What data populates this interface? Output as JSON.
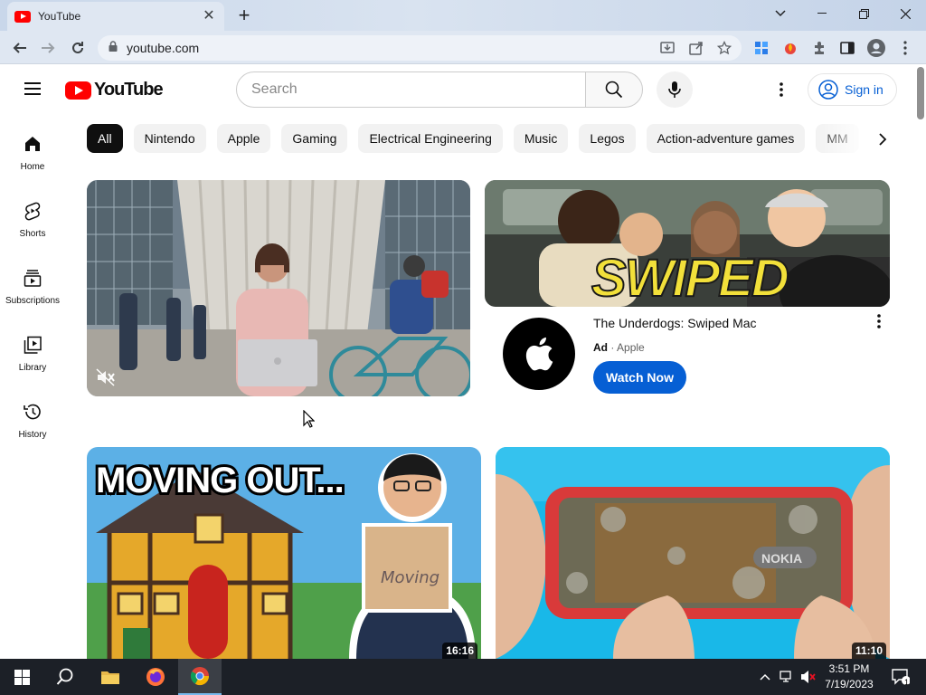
{
  "browser": {
    "tab_title": "YouTube",
    "url": "youtube.com"
  },
  "masthead": {
    "logo_text": "YouTube",
    "search_placeholder": "Search",
    "signin_label": "Sign in"
  },
  "chips": [
    "All",
    "Nintendo",
    "Apple",
    "Gaming",
    "Electrical Engineering",
    "Music",
    "Legos",
    "Action-adventure games",
    "MM"
  ],
  "guide": [
    {
      "label": "Home",
      "icon": "home-icon"
    },
    {
      "label": "Shorts",
      "icon": "shorts-icon"
    },
    {
      "label": "Subscriptions",
      "icon": "subscriptions-icon"
    },
    {
      "label": "Library",
      "icon": "library-icon"
    },
    {
      "label": "History",
      "icon": "history-icon"
    }
  ],
  "ad": {
    "thumbnail_text": "SWIPED",
    "title": "The Underdogs: Swiped Mac",
    "tag": "Ad",
    "advertiser": "Apple",
    "cta_label": "Watch Now"
  },
  "videos": [
    {
      "thumbnail_text": "MOVING OUT...",
      "box_text": "Moving",
      "duration": "16:16"
    },
    {
      "thumbnail_text": "NOKIA",
      "duration": "11:10"
    }
  ],
  "taskbar": {
    "time": "3:51 PM",
    "date": "7/19/2023",
    "notification_count": "1"
  },
  "colors": {
    "youtube_red": "#ff0000",
    "link_blue": "#065fd4",
    "chip_active": "#0f0f0f"
  }
}
